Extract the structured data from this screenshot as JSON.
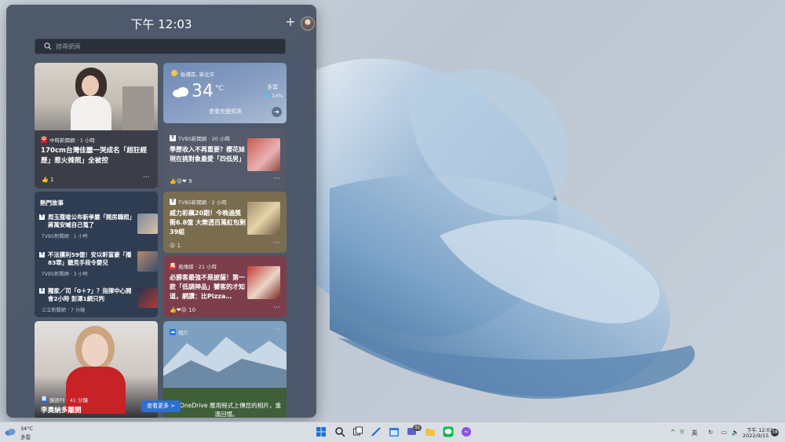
{
  "widgets": {
    "clock": "下午 12:03",
    "search_placeholder": "搜尋網頁",
    "see_more": "查看更多 >"
  },
  "card1": {
    "source": "中時新聞網 · 1 小時",
    "headline": "170cm台灣佳麗一哭成名「超狂經歷」惹火辣照」全被挖",
    "reactions": "1"
  },
  "weather": {
    "location": "板橋區, 新北市",
    "temp": "34",
    "unit": "°C",
    "condition": "多雲",
    "precip": "14%",
    "forecast": "查看完整預測"
  },
  "card3": {
    "source": "TVBS新聞網 · 20 小時",
    "headline": "學歷收入不再重要？櫻花妹現在挑對象最愛「四低男」",
    "reactions": "9"
  },
  "card4": {
    "source": "TVBS新聞網 · 2 小時",
    "headline": "威力彩飆20期！今晚過獎衝6.8億 大樂透百萬紅包剩39組",
    "reactions": "1"
  },
  "card5": {
    "source": "風傳媒 · 21 小時",
    "headline": "必勝客最強不是披薩！第一款「低調神品」饕客的才知道，網讚：比Pizza…",
    "reactions": "10"
  },
  "hot": {
    "title": "熱門故事",
    "stories": [
      {
        "text": "周玉蔻嗆公布新孝嚴「開房職照」蔣萬安喊自己蒐了",
        "meta": "TVBS新聞網 · 1 小時"
      },
      {
        "text": "不法獲利59億！安以軒富豪「播83罪」聽見手段令嬰兒",
        "meta": "TVBS新聞網 · 3 小時"
      },
      {
        "text": "獨家／司「0＋7」？指揮中心開會2小時 彭澤1網只判",
        "meta": "三立新聞網 · 7 分鐘"
      }
    ]
  },
  "card6": {
    "source": "鏡週刊 · 41 分鐘",
    "headline": "李奧納多離開"
  },
  "card7": {
    "source": "相片",
    "headline": "在 OneDrive 應用程式上傳您的相片，重溫回憶。"
  },
  "taskbar": {
    "weather_temp": "34°C",
    "weather_cond": "多雲",
    "ime": "英",
    "time": "下午 12:03",
    "date": "2022/9/15",
    "notif": "38",
    "badge": "32"
  }
}
